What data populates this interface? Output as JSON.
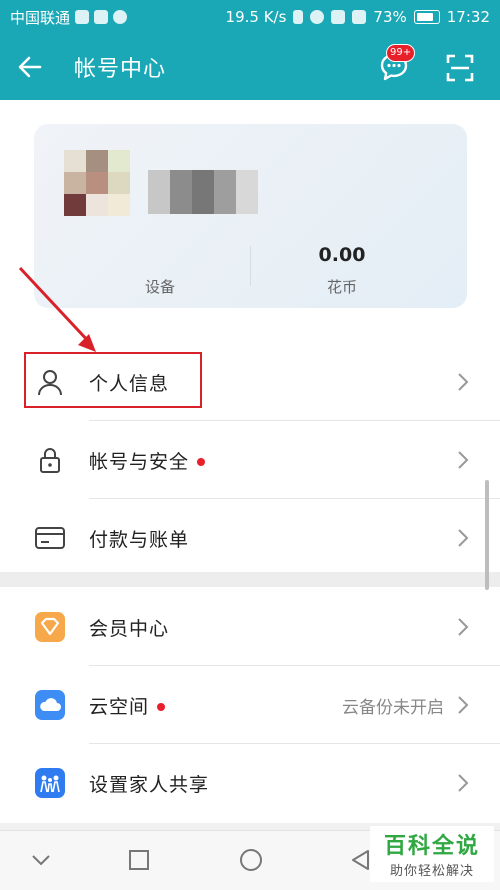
{
  "status_bar": {
    "carrier": "中国联通",
    "speed": "19.5 K/s",
    "battery": "73%",
    "time": "17:32"
  },
  "app_bar": {
    "title": "帐号中心",
    "message_badge": "99+"
  },
  "account_card": {
    "stats": [
      {
        "value": "",
        "label": "设备"
      },
      {
        "value": "0.00",
        "label": "花币"
      }
    ]
  },
  "menu_primary": [
    {
      "label": "个人信息",
      "icon": "person-icon",
      "has_dot": false,
      "extra": ""
    },
    {
      "label": "帐号与安全",
      "icon": "lock-icon",
      "has_dot": true,
      "extra": ""
    },
    {
      "label": "付款与账单",
      "icon": "card-icon",
      "has_dot": false,
      "extra": ""
    }
  ],
  "menu_secondary": [
    {
      "label": "会员中心",
      "icon": "member-diamond-icon",
      "has_dot": false,
      "extra": "",
      "color": "#f7a84a"
    },
    {
      "label": "云空间",
      "icon": "cloud-icon",
      "has_dot": true,
      "extra": "云备份未开启",
      "color": "#3d8df5"
    },
    {
      "label": "设置家人共享",
      "icon": "family-share-icon",
      "has_dot": false,
      "extra": "",
      "color": "#2f7cf0"
    }
  ],
  "annotation": {
    "highlight_color": "#d9212a"
  },
  "watermark": {
    "title": "百科全说",
    "subtitle": "助你轻松解决"
  }
}
